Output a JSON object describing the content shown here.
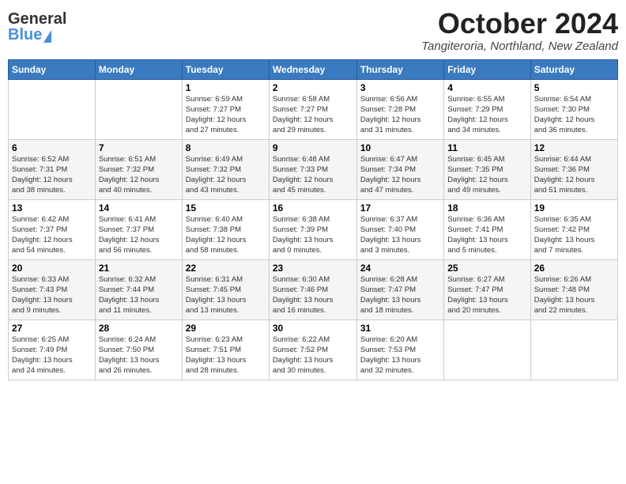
{
  "header": {
    "logo_text_general": "General",
    "logo_text_blue": "Blue",
    "month_title": "October 2024",
    "location": "Tangiteroria, Northland, New Zealand"
  },
  "days_of_week": [
    "Sunday",
    "Monday",
    "Tuesday",
    "Wednesday",
    "Thursday",
    "Friday",
    "Saturday"
  ],
  "weeks": [
    [
      {
        "day": "",
        "info": ""
      },
      {
        "day": "",
        "info": ""
      },
      {
        "day": "1",
        "info": "Sunrise: 6:59 AM\nSunset: 7:27 PM\nDaylight: 12 hours\nand 27 minutes."
      },
      {
        "day": "2",
        "info": "Sunrise: 6:58 AM\nSunset: 7:27 PM\nDaylight: 12 hours\nand 29 minutes."
      },
      {
        "day": "3",
        "info": "Sunrise: 6:56 AM\nSunset: 7:28 PM\nDaylight: 12 hours\nand 31 minutes."
      },
      {
        "day": "4",
        "info": "Sunrise: 6:55 AM\nSunset: 7:29 PM\nDaylight: 12 hours\nand 34 minutes."
      },
      {
        "day": "5",
        "info": "Sunrise: 6:54 AM\nSunset: 7:30 PM\nDaylight: 12 hours\nand 36 minutes."
      }
    ],
    [
      {
        "day": "6",
        "info": "Sunrise: 6:52 AM\nSunset: 7:31 PM\nDaylight: 12 hours\nand 38 minutes."
      },
      {
        "day": "7",
        "info": "Sunrise: 6:51 AM\nSunset: 7:32 PM\nDaylight: 12 hours\nand 40 minutes."
      },
      {
        "day": "8",
        "info": "Sunrise: 6:49 AM\nSunset: 7:32 PM\nDaylight: 12 hours\nand 43 minutes."
      },
      {
        "day": "9",
        "info": "Sunrise: 6:48 AM\nSunset: 7:33 PM\nDaylight: 12 hours\nand 45 minutes."
      },
      {
        "day": "10",
        "info": "Sunrise: 6:47 AM\nSunset: 7:34 PM\nDaylight: 12 hours\nand 47 minutes."
      },
      {
        "day": "11",
        "info": "Sunrise: 6:45 AM\nSunset: 7:35 PM\nDaylight: 12 hours\nand 49 minutes."
      },
      {
        "day": "12",
        "info": "Sunrise: 6:44 AM\nSunset: 7:36 PM\nDaylight: 12 hours\nand 51 minutes."
      }
    ],
    [
      {
        "day": "13",
        "info": "Sunrise: 6:42 AM\nSunset: 7:37 PM\nDaylight: 12 hours\nand 54 minutes."
      },
      {
        "day": "14",
        "info": "Sunrise: 6:41 AM\nSunset: 7:37 PM\nDaylight: 12 hours\nand 56 minutes."
      },
      {
        "day": "15",
        "info": "Sunrise: 6:40 AM\nSunset: 7:38 PM\nDaylight: 12 hours\nand 58 minutes."
      },
      {
        "day": "16",
        "info": "Sunrise: 6:38 AM\nSunset: 7:39 PM\nDaylight: 13 hours\nand 0 minutes."
      },
      {
        "day": "17",
        "info": "Sunrise: 6:37 AM\nSunset: 7:40 PM\nDaylight: 13 hours\nand 3 minutes."
      },
      {
        "day": "18",
        "info": "Sunrise: 6:36 AM\nSunset: 7:41 PM\nDaylight: 13 hours\nand 5 minutes."
      },
      {
        "day": "19",
        "info": "Sunrise: 6:35 AM\nSunset: 7:42 PM\nDaylight: 13 hours\nand 7 minutes."
      }
    ],
    [
      {
        "day": "20",
        "info": "Sunrise: 6:33 AM\nSunset: 7:43 PM\nDaylight: 13 hours\nand 9 minutes."
      },
      {
        "day": "21",
        "info": "Sunrise: 6:32 AM\nSunset: 7:44 PM\nDaylight: 13 hours\nand 11 minutes."
      },
      {
        "day": "22",
        "info": "Sunrise: 6:31 AM\nSunset: 7:45 PM\nDaylight: 13 hours\nand 13 minutes."
      },
      {
        "day": "23",
        "info": "Sunrise: 6:30 AM\nSunset: 7:46 PM\nDaylight: 13 hours\nand 16 minutes."
      },
      {
        "day": "24",
        "info": "Sunrise: 6:28 AM\nSunset: 7:47 PM\nDaylight: 13 hours\nand 18 minutes."
      },
      {
        "day": "25",
        "info": "Sunrise: 6:27 AM\nSunset: 7:47 PM\nDaylight: 13 hours\nand 20 minutes."
      },
      {
        "day": "26",
        "info": "Sunrise: 6:26 AM\nSunset: 7:48 PM\nDaylight: 13 hours\nand 22 minutes."
      }
    ],
    [
      {
        "day": "27",
        "info": "Sunrise: 6:25 AM\nSunset: 7:49 PM\nDaylight: 13 hours\nand 24 minutes."
      },
      {
        "day": "28",
        "info": "Sunrise: 6:24 AM\nSunset: 7:50 PM\nDaylight: 13 hours\nand 26 minutes."
      },
      {
        "day": "29",
        "info": "Sunrise: 6:23 AM\nSunset: 7:51 PM\nDaylight: 13 hours\nand 28 minutes."
      },
      {
        "day": "30",
        "info": "Sunrise: 6:22 AM\nSunset: 7:52 PM\nDaylight: 13 hours\nand 30 minutes."
      },
      {
        "day": "31",
        "info": "Sunrise: 6:20 AM\nSunset: 7:53 PM\nDaylight: 13 hours\nand 32 minutes."
      },
      {
        "day": "",
        "info": ""
      },
      {
        "day": "",
        "info": ""
      }
    ]
  ]
}
